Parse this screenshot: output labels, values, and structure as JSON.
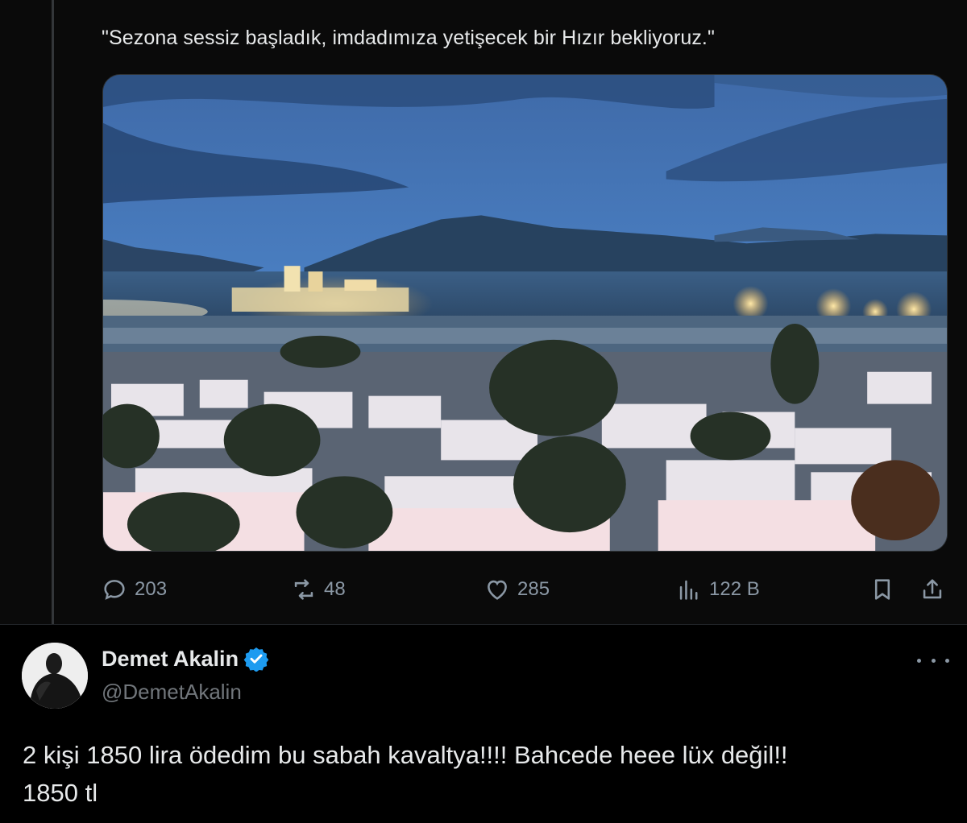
{
  "quoted_tweet": {
    "text": "\"Sezona sessiz başladık, imdadımıza yetişecek bir Hızır bekliyoruz.\"",
    "actions": {
      "reply_count": "203",
      "retweet_count": "48",
      "like_count": "285",
      "views_count": "122 B"
    }
  },
  "reply_tweet": {
    "display_name": "Demet Akalin",
    "handle": "@DemetAkalin",
    "text_line1": "2 kişi 1850 lira ödedim bu sabah kavaltya!!!! Bahcede heee lüx değil!!",
    "text_line2": "1850 tl"
  },
  "colors": {
    "background": "#000000",
    "text": "#e7e9ea",
    "muted": "#71767b",
    "verified": "#1d9bf0"
  }
}
